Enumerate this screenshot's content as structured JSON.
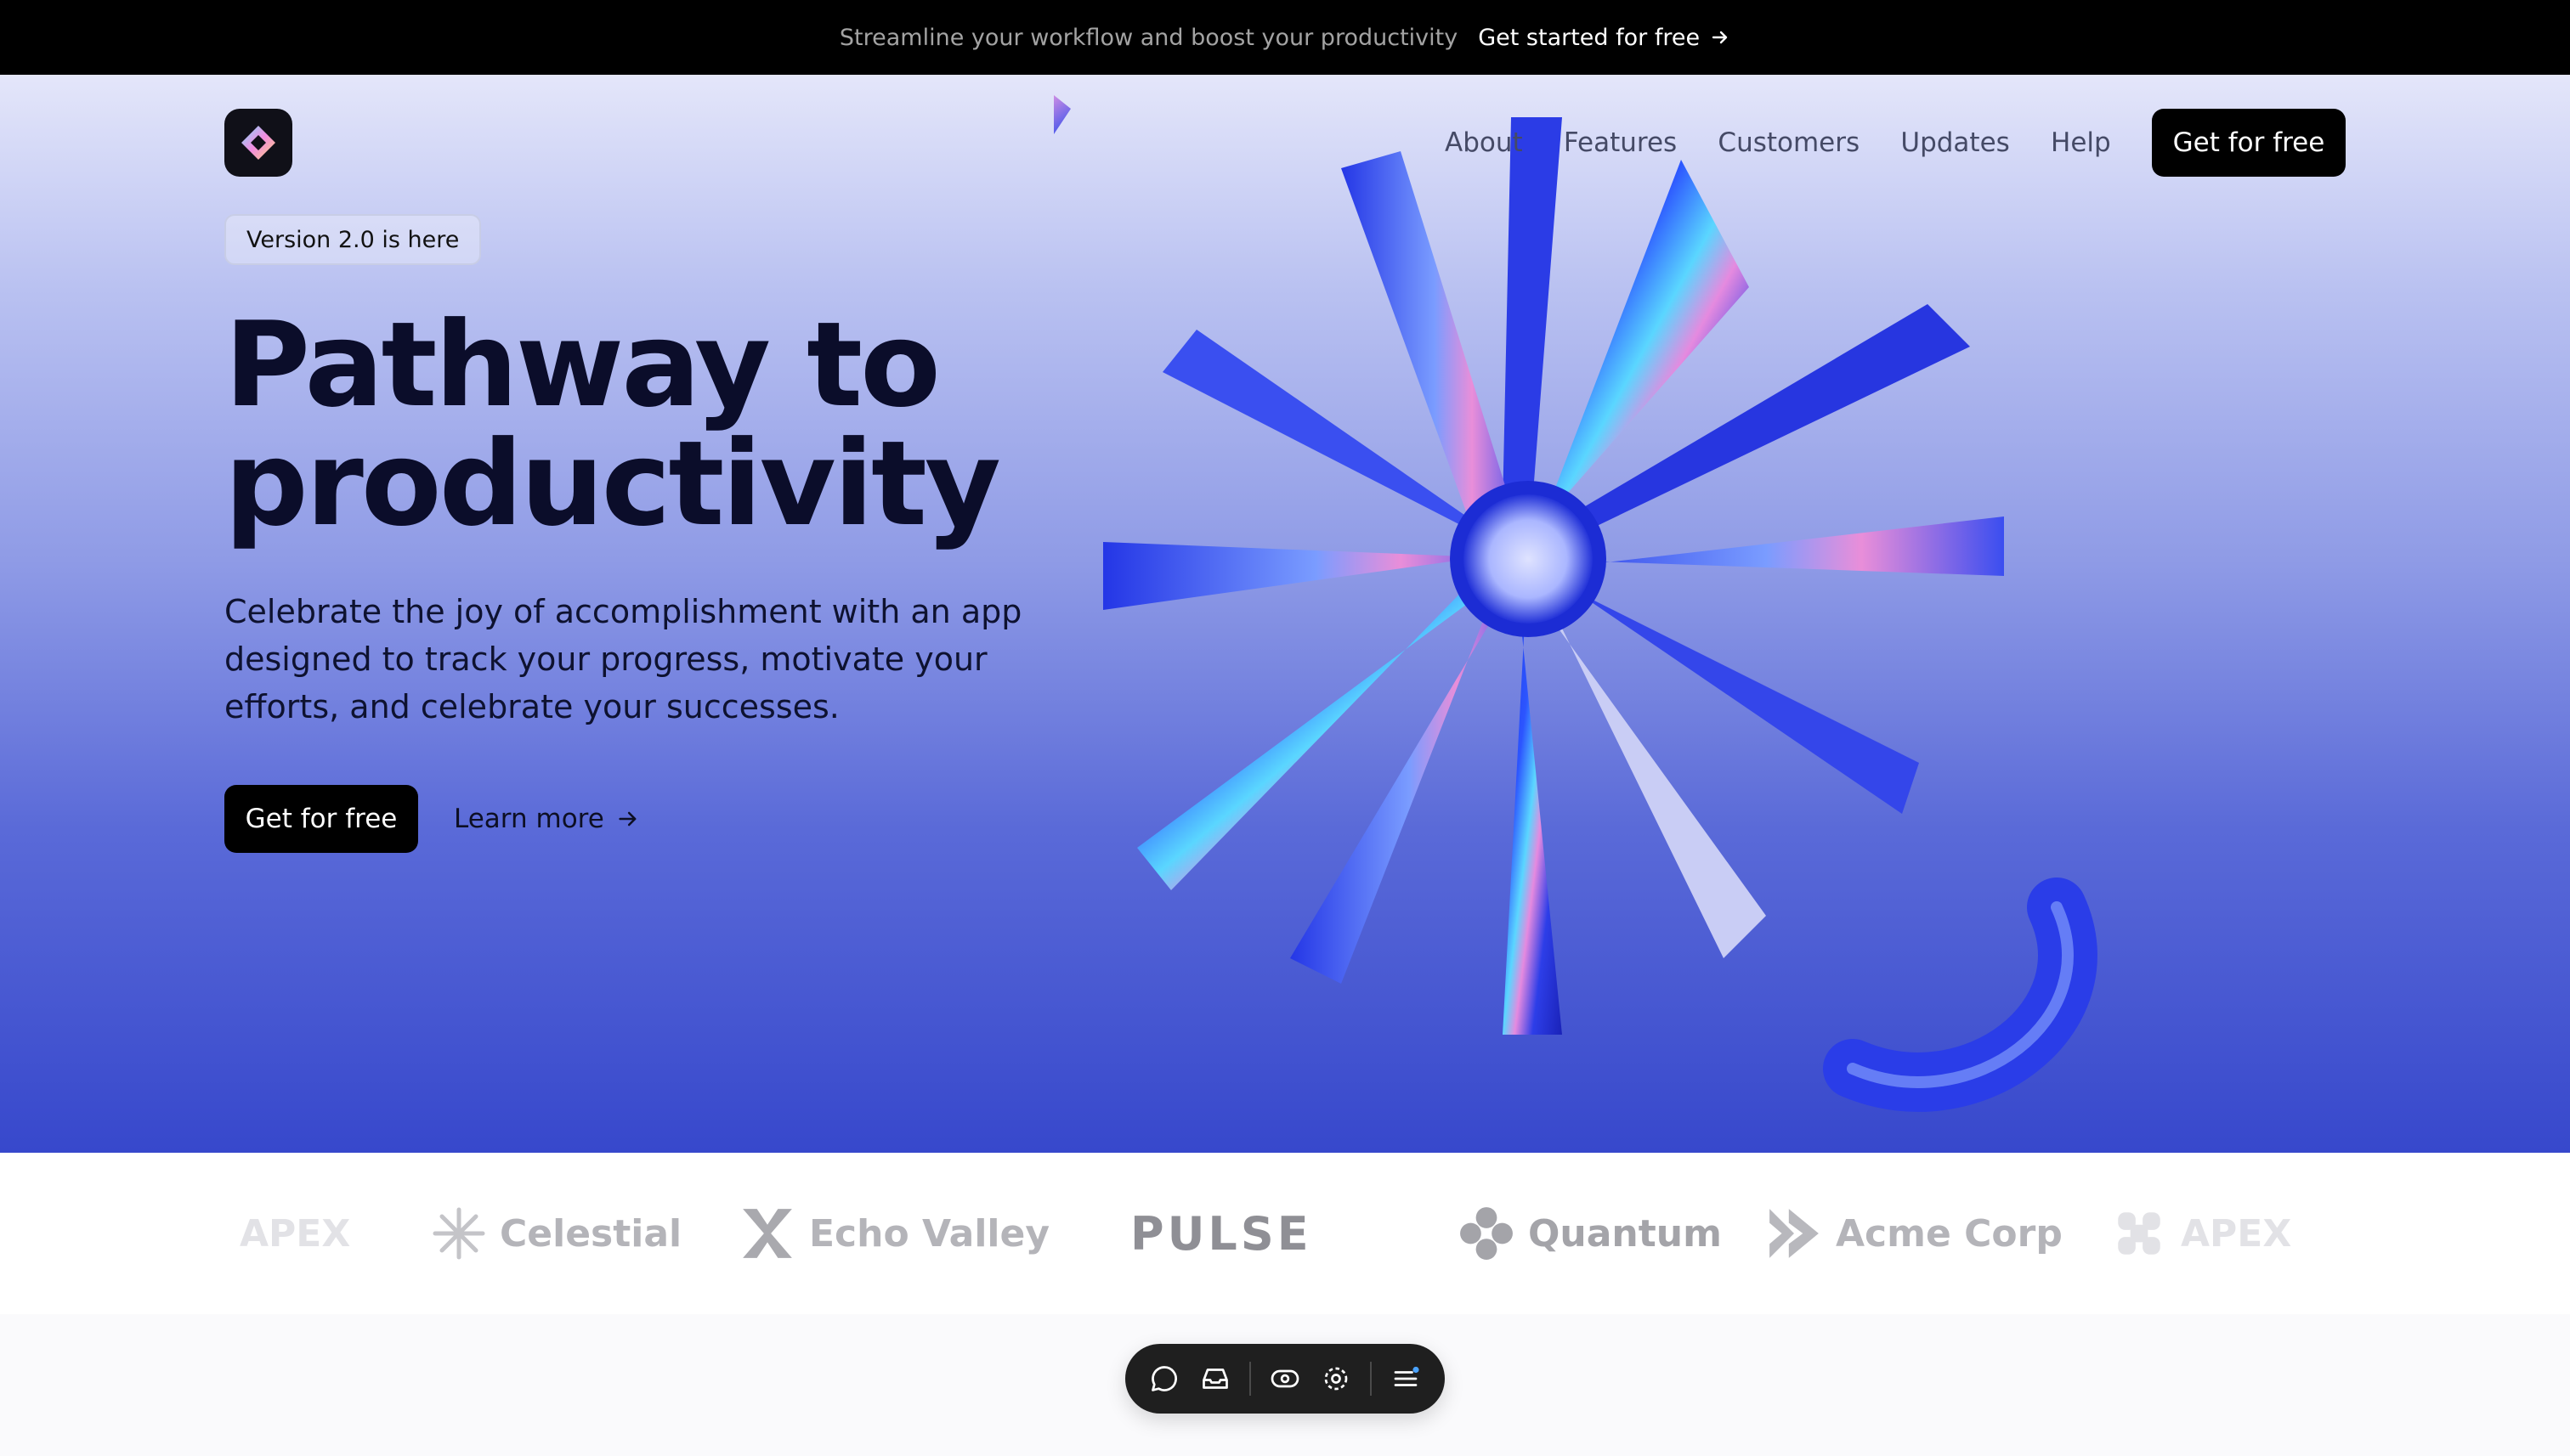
{
  "announcement": {
    "message": "Streamline your workflow and boost your productivity",
    "cta": "Get started for free"
  },
  "nav": {
    "links": [
      "About",
      "Features",
      "Customers",
      "Updates",
      "Help"
    ],
    "cta": "Get for free"
  },
  "hero": {
    "badge": "Version 2.0 is here",
    "headline_line1": "Pathway to",
    "headline_line2": "productivity",
    "subtext": "Celebrate the joy of accomplishment with an app designed to track your progress, motivate your efforts, and celebrate your successes.",
    "primary_cta": "Get for free",
    "secondary_cta": "Learn more"
  },
  "customers": [
    {
      "name": "APEX",
      "icon": "apex-icon"
    },
    {
      "name": "Celestial",
      "icon": "celestial-icon"
    },
    {
      "name": "Echo Valley",
      "icon": "echo-valley-icon"
    },
    {
      "name": "PULSE",
      "icon": ""
    },
    {
      "name": "Quantum",
      "icon": "quantum-icon"
    },
    {
      "name": "Acme Corp",
      "icon": "acme-corp-icon"
    },
    {
      "name": "APEX",
      "icon": "apex-icon"
    }
  ],
  "dock": {
    "icons": [
      "comment-icon",
      "inbox-icon",
      "eye-icon",
      "settings-icon",
      "menu-icon"
    ]
  },
  "colors": {
    "announcement_bg": "#000000",
    "primary_button": "#000000",
    "hero_gradient_top": "#e4e6fa",
    "hero_gradient_bottom": "#3748cc",
    "logo_gray": "#b4b4b9"
  }
}
